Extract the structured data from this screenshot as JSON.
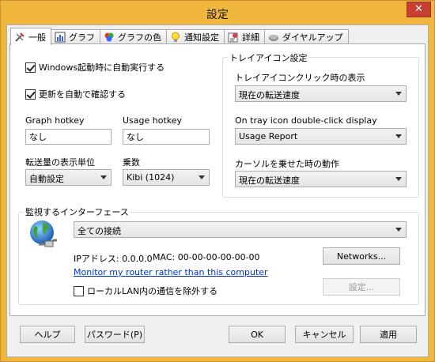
{
  "window": {
    "title": "設定",
    "close_label": "✕"
  },
  "tabs": [
    {
      "label": "一般",
      "icon": "tools-icon"
    },
    {
      "label": "グラフ",
      "icon": "chart-icon"
    },
    {
      "label": "グラフの色",
      "icon": "palette-icon"
    },
    {
      "label": "通知設定",
      "icon": "bulb-icon"
    },
    {
      "label": "詳細",
      "icon": "details-icon"
    },
    {
      "label": "ダイヤルアップ",
      "icon": "dialup-icon"
    }
  ],
  "general": {
    "autostart_label": "Windows起動時に自動実行する",
    "autoupdate_label": "更新を自動で確認する",
    "graph_hotkey_label": "Graph hotkey",
    "graph_hotkey_value": "なし",
    "usage_hotkey_label": "Usage hotkey",
    "usage_hotkey_value": "なし",
    "unit_label": "転送量の表示単位",
    "unit_value": "自動設定",
    "multiplier_label": "乗数",
    "multiplier_value": "Kibi (1024)"
  },
  "tray": {
    "group_label": "トレイアイコン設定",
    "click_label": "トレイアイコンクリック時の表示",
    "click_value": "現在の転送速度",
    "dblclick_label": "On tray icon double-click display",
    "dblclick_value": "Usage Report",
    "hover_label": "カーソルを乗せた時の動作",
    "hover_value": "現在の転送速度"
  },
  "interface": {
    "group_label": "監視するインターフェース",
    "selected": "全ての接続",
    "ip_text": "IPアドレス: 0.0.0.0",
    "mac_text": "MAC: 00-00-00-00-00-00",
    "networks_button": "Networks...",
    "router_link": "Monitor my router rather than this computer",
    "settings_button": "設定...",
    "exclude_lan_label": "ローカルLAN内の通信を除外する"
  },
  "footer": {
    "help": "ヘルプ",
    "password": "パスワード(P)",
    "ok": "OK",
    "cancel": "キャンセル",
    "apply": "適用"
  }
}
